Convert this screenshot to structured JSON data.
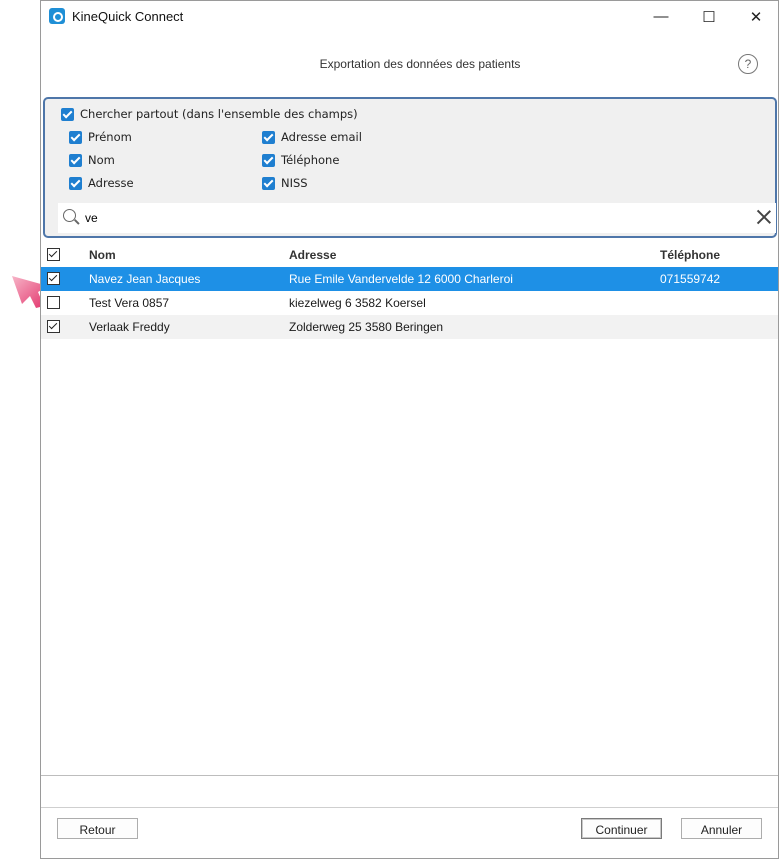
{
  "window": {
    "title": "KineQuick Connect",
    "minimize": "—",
    "maximize": "☐",
    "close": "✕"
  },
  "header": {
    "subtitle": "Exportation des données des patients",
    "help": "?"
  },
  "filters": {
    "search_everywhere": "Chercher partout (dans l'ensemble des champs)",
    "fields": {
      "prenom": "Prénom",
      "nom": "Nom",
      "adresse": "Adresse",
      "email": "Adresse email",
      "telephone": "Téléphone",
      "niss": "NISS"
    },
    "search_value": "ve"
  },
  "grid": {
    "columns": {
      "nom": "Nom",
      "adresse": "Adresse",
      "telephone": "Téléphone"
    },
    "rows": [
      {
        "nom": "Navez Jean Jacques",
        "adresse": "Rue Emile Vandervelde 12 6000 Charleroi",
        "telephone": "071559742",
        "checked": true
      },
      {
        "nom": "Test Vera 0857",
        "adresse": "kiezelweg 6 3582 Koersel",
        "telephone": "",
        "checked": false
      },
      {
        "nom": "Verlaak Freddy",
        "adresse": "Zolderweg 25 3580 Beringen",
        "telephone": "",
        "checked": true
      }
    ]
  },
  "footer": {
    "back": "Retour",
    "continue": "Continuer",
    "cancel": "Annuler"
  },
  "colors": {
    "selection": "#1e90e6",
    "checkbox_accent": "#1f7fd0",
    "panel_border": "#4e76a9"
  }
}
